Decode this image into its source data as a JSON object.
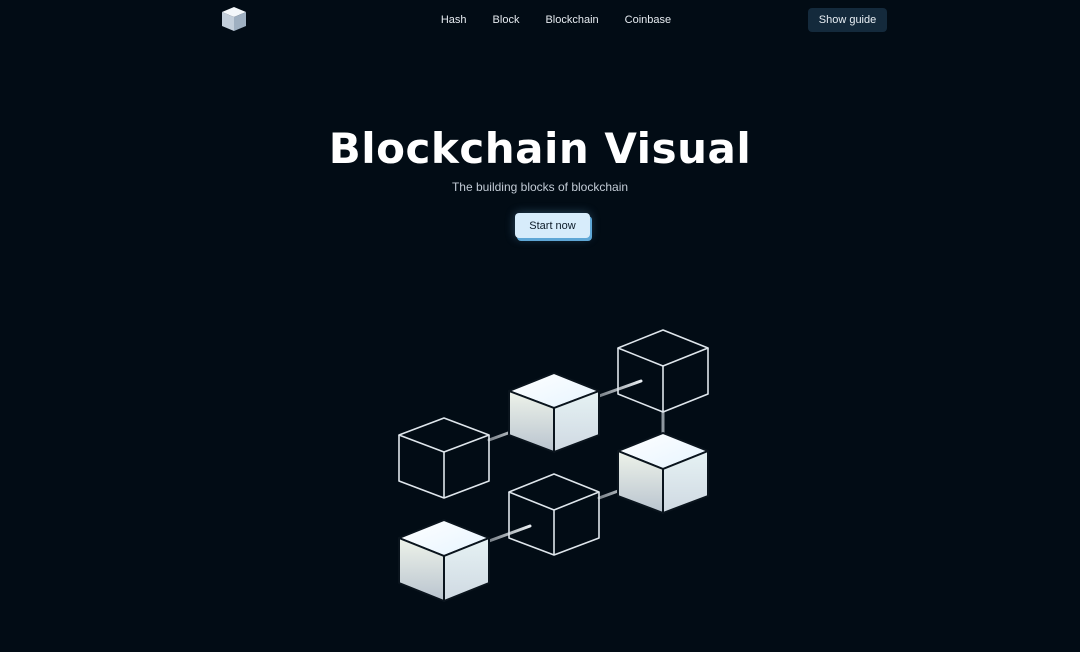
{
  "nav": {
    "logo_icon": "cube-icon",
    "items": [
      {
        "label": "Hash"
      },
      {
        "label": "Block"
      },
      {
        "label": "Blockchain"
      },
      {
        "label": "Coinbase"
      }
    ],
    "guide_label": "Show guide"
  },
  "hero": {
    "title": "Blockchain Visual",
    "subtitle": "The building blocks of blockchain",
    "cta_label": "Start now"
  },
  "colors": {
    "background": "#020c15",
    "button_dark": "#142a3c",
    "cta_fill": "#d7ecfb",
    "cta_shadow": "#5fa7d6"
  },
  "illustration": {
    "icon": "blockchain-cubes-illustration",
    "cubes": [
      {
        "name": "cube-outline-left",
        "filled": false
      },
      {
        "name": "cube-filled-middle-top",
        "filled": true
      },
      {
        "name": "cube-outline-right-top",
        "filled": false
      },
      {
        "name": "cube-filled-right-middle",
        "filled": true
      },
      {
        "name": "cube-outline-middle-bottom",
        "filled": false
      },
      {
        "name": "cube-filled-left-bottom",
        "filled": true
      }
    ]
  }
}
